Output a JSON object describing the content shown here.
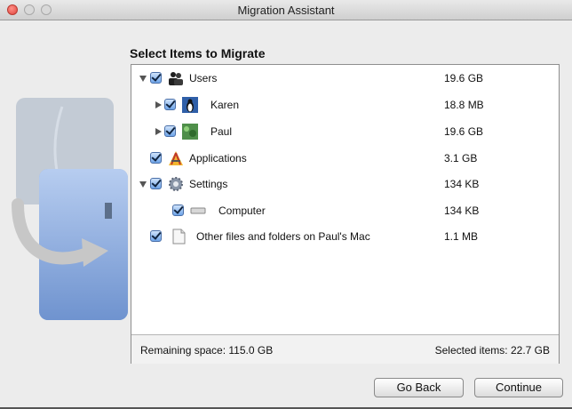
{
  "window": {
    "title": "Migration Assistant"
  },
  "heading": "Select Items to Migrate",
  "items": [
    {
      "label": "Users",
      "size": "19.6 GB",
      "disclosure": "expanded",
      "checked": true,
      "icon": "users-icon"
    },
    {
      "label": "Karen",
      "size": "18.8 MB",
      "disclosure": "collapsed",
      "checked": true,
      "icon": "penguin-user-icon"
    },
    {
      "label": "Paul",
      "size": "19.6 GB",
      "disclosure": "collapsed",
      "checked": true,
      "icon": "green-user-icon"
    },
    {
      "label": "Applications",
      "size": "3.1 GB",
      "disclosure": "none",
      "checked": true,
      "icon": "applications-icon"
    },
    {
      "label": "Settings",
      "size": "134 KB",
      "disclosure": "expanded",
      "checked": true,
      "icon": "gear-icon"
    },
    {
      "label": "Computer",
      "size": "134 KB",
      "disclosure": "none",
      "checked": true,
      "icon": "computer-icon"
    },
    {
      "label": "Other files and folders on Paul's Mac",
      "size": "1.1 MB",
      "disclosure": "none",
      "checked": true,
      "icon": "document-icon"
    }
  ],
  "footer": {
    "remaining": "Remaining space: 115.0 GB",
    "selected": "Selected items: 22.7 GB"
  },
  "buttons": {
    "back": "Go Back",
    "continue": "Continue"
  }
}
